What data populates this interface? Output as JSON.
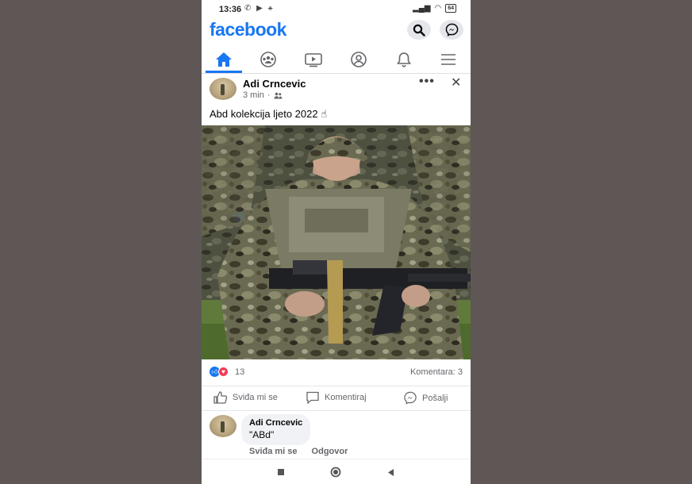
{
  "status_bar": {
    "time": "13:36",
    "battery": "64"
  },
  "header": {
    "brand": "facebook"
  },
  "tabs": [
    {
      "name": "home",
      "active": true
    },
    {
      "name": "groups",
      "active": false
    },
    {
      "name": "watch",
      "active": false
    },
    {
      "name": "profile",
      "active": false
    },
    {
      "name": "notifications",
      "active": false
    },
    {
      "name": "menu",
      "active": false
    }
  ],
  "post": {
    "author": "Adi Crncevic",
    "time": "3 min",
    "audience_icon": "friends-icon",
    "text": "Abd kolekcija ljeto 2022 ☝",
    "reaction_count": "13",
    "comment_count": "Komentara: 3"
  },
  "actions": {
    "like": "Sviđa mi se",
    "comment": "Komentiraj",
    "share": "Pošalji"
  },
  "comment": {
    "author": "Adi Crncevic",
    "text": "\"ABd\"",
    "like": "Sviđa mi se",
    "reply": "Odgovor"
  },
  "colors": {
    "brand": "#1877f2",
    "background": "#5f5756",
    "like": "#1877f2",
    "love": "#f33e58"
  }
}
